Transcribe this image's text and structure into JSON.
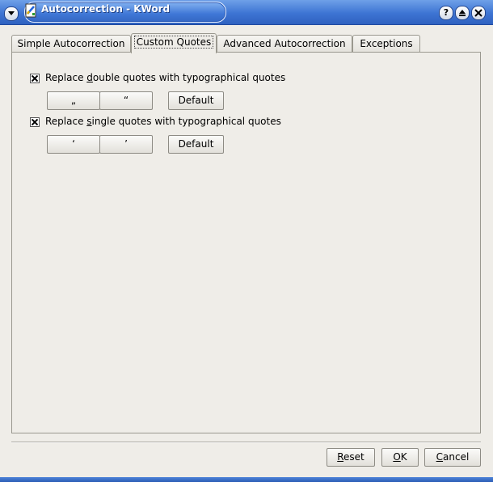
{
  "window": {
    "title": "Autocorrection - KWord",
    "buttons": {
      "help": "?",
      "shade_icon": "shade-icon",
      "close_icon": "close-icon"
    }
  },
  "tabs": [
    {
      "label": "Simple Autocorrection",
      "active": false
    },
    {
      "label": "Custom Quotes",
      "active": true
    },
    {
      "label": "Advanced Autocorrection",
      "active": false
    },
    {
      "label": "Exceptions",
      "active": false
    }
  ],
  "double_quotes": {
    "checked": true,
    "label_before": "Replace ",
    "label_mnemonic": "d",
    "label_after": "ouble quotes with typographical quotes",
    "open_quote": "„",
    "close_quote": "“",
    "default_label": "Default"
  },
  "single_quotes": {
    "checked": true,
    "label_before": "Replace ",
    "label_mnemonic": "s",
    "label_after": "ingle quotes with typographical quotes",
    "open_quote": "‘",
    "close_quote": "’",
    "default_label": "Default"
  },
  "footer": {
    "reset_mnemonic": "R",
    "reset_rest": "eset",
    "ok_mnemonic": "O",
    "ok_rest": "K",
    "cancel_mnemonic": "C",
    "cancel_rest": "ancel"
  },
  "colors": {
    "titlebar": "#3d74d3",
    "dialog_bg": "#efede8",
    "border": "#9a988f"
  }
}
